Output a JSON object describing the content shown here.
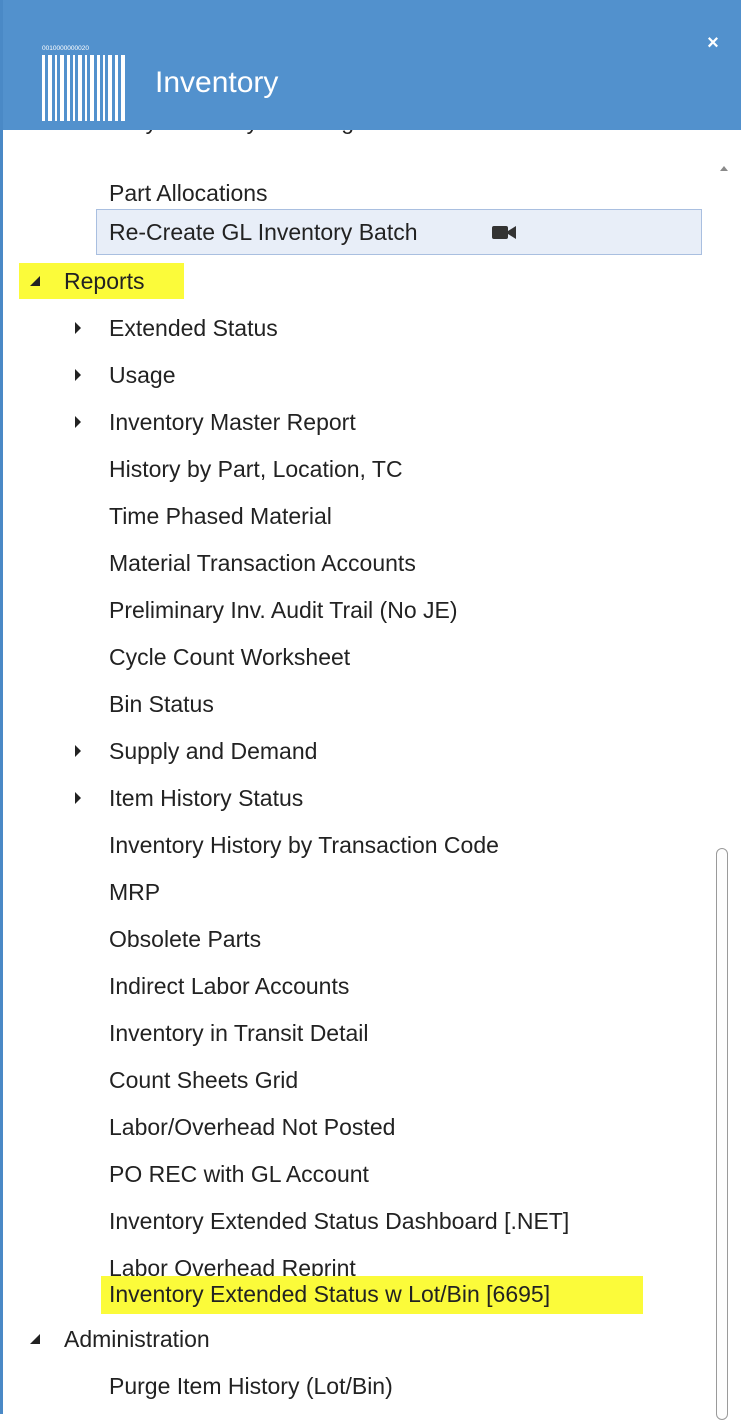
{
  "window": {
    "title": "Inventory",
    "close_label": "×",
    "logo_text": "0010000000020"
  },
  "tree": {
    "cutoff_label": "Daily Inventory Trending",
    "part_allocations": "Part Allocations",
    "recreate_gl": "Re-Create GL Inventory Batch",
    "reports": "Reports",
    "extended_status": "Extended Status",
    "usage": "Usage",
    "inventory_master_report": "Inventory Master Report",
    "history_by_part": "History by Part, Location, TC",
    "time_phased_material": "Time Phased Material",
    "material_transaction_accounts": "Material Transaction Accounts",
    "preliminary_audit_trail": "Preliminary Inv. Audit Trail (No JE)",
    "cycle_count_worksheet": "Cycle Count Worksheet",
    "bin_status": "Bin Status",
    "supply_and_demand": "Supply and Demand",
    "item_history_status": "Item History Status",
    "inventory_history_by_tc": "Inventory History by Transaction Code",
    "mrp": "MRP",
    "obsolete_parts": "Obsolete Parts",
    "indirect_labor_accounts": "Indirect Labor Accounts",
    "inventory_in_transit": "Inventory in Transit Detail",
    "count_sheets_grid": "Count Sheets Grid",
    "labor_overhead_not_posted": "Labor/Overhead Not Posted",
    "po_rec_gl": "PO REC with GL Account",
    "ext_status_dashboard": "Inventory Extended Status Dashboard [.NET]",
    "labor_overhead_reprint": "Labor Overhead Reprint",
    "ext_status_lot_bin": "Inventory Extended Status w Lot/Bin [6695]",
    "administration": "Administration",
    "purge_item_history": "Purge Item History (Lot/Bin)"
  },
  "colors": {
    "header": "#5291cd",
    "highlight": "#fbfb3a",
    "selected_row": "#e8eef8"
  }
}
